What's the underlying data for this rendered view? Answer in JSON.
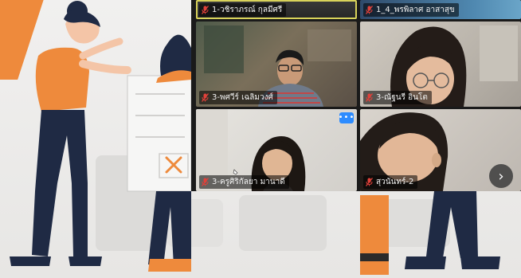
{
  "participants": [
    {
      "name": "1-วชิราภรณ์ กุลมีศรี",
      "muted": true,
      "active": true
    },
    {
      "name": "1_4_พรพิลาศ อาสาสุข",
      "muted": true,
      "active": false
    },
    {
      "name": "3-พศวีร์ เฉลิมวงศ์",
      "muted": true,
      "active": false
    },
    {
      "name": "3-ณัฐนรี อินโต",
      "muted": true,
      "active": false
    },
    {
      "name": "3-ครูศิริกัลยา มานาดี",
      "muted": true,
      "active": false
    },
    {
      "name": "สุวนันทร์-2",
      "muted": true,
      "active": false
    }
  ],
  "controls": {
    "more_label": "•••",
    "next_label": "›"
  },
  "colors": {
    "accent": "#ee8a3c",
    "mic_muted": "#e0413a",
    "active_border": "#d9d35a",
    "more_button": "#2d8cff"
  }
}
